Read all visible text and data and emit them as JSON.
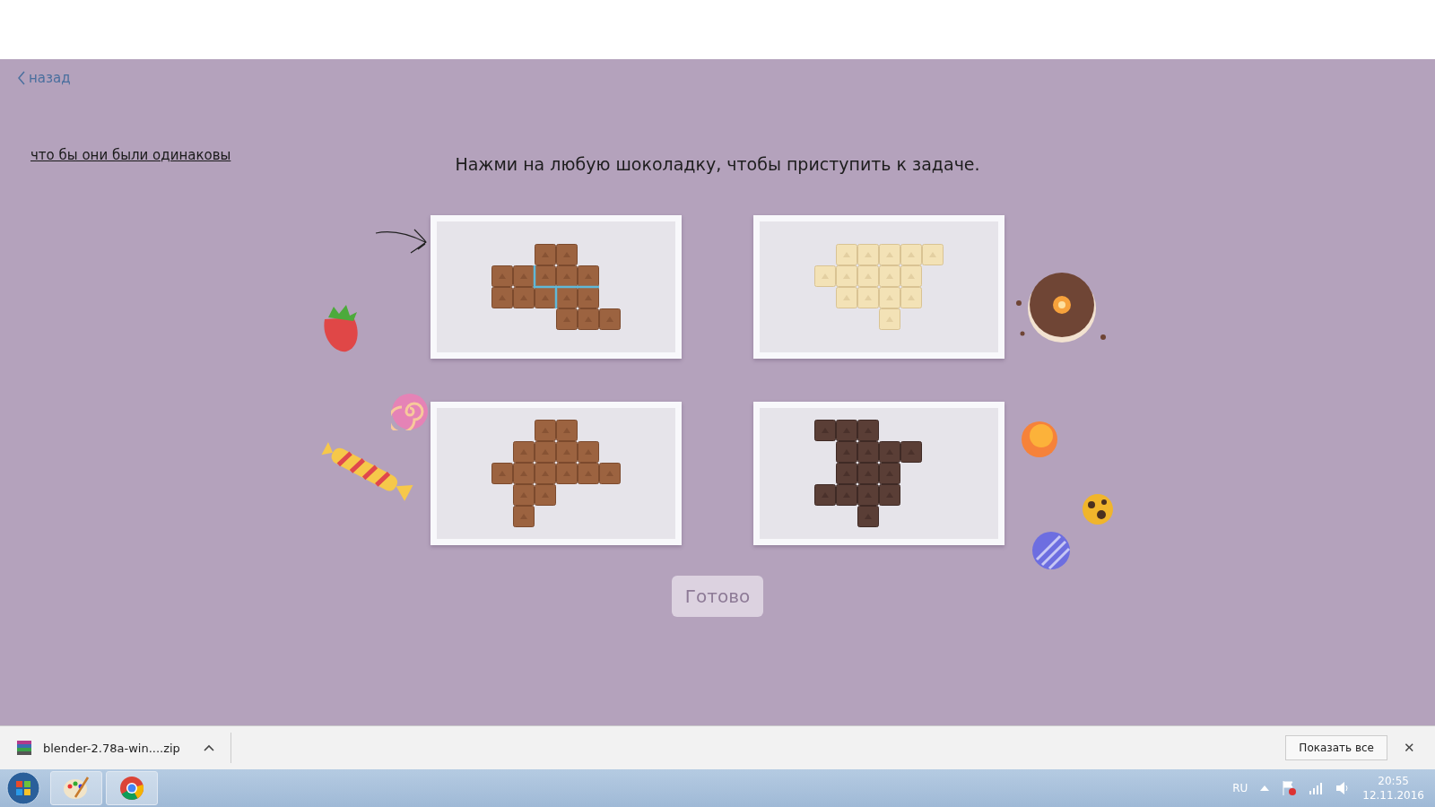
{
  "back_link": {
    "label": "назад"
  },
  "hint_link": {
    "label": "что бы они были одинаковы"
  },
  "instruction": "Нажми на любую шоколадку, чтобы приступить к задаче.",
  "bars": [
    {
      "kind": "milk",
      "cut_lines": true
    },
    {
      "kind": "white",
      "cut_lines": false
    },
    {
      "kind": "milk",
      "cut_lines": false
    },
    {
      "kind": "dark",
      "cut_lines": false
    }
  ],
  "ready_button": {
    "label": "Готово",
    "disabled": true
  },
  "download_bar": {
    "file": "blender-2.78a-win....zip",
    "show_all": "Показать все",
    "close": "✕"
  },
  "taskbar": {
    "language": "RU",
    "time": "20:55",
    "date": "12.11.2016"
  }
}
